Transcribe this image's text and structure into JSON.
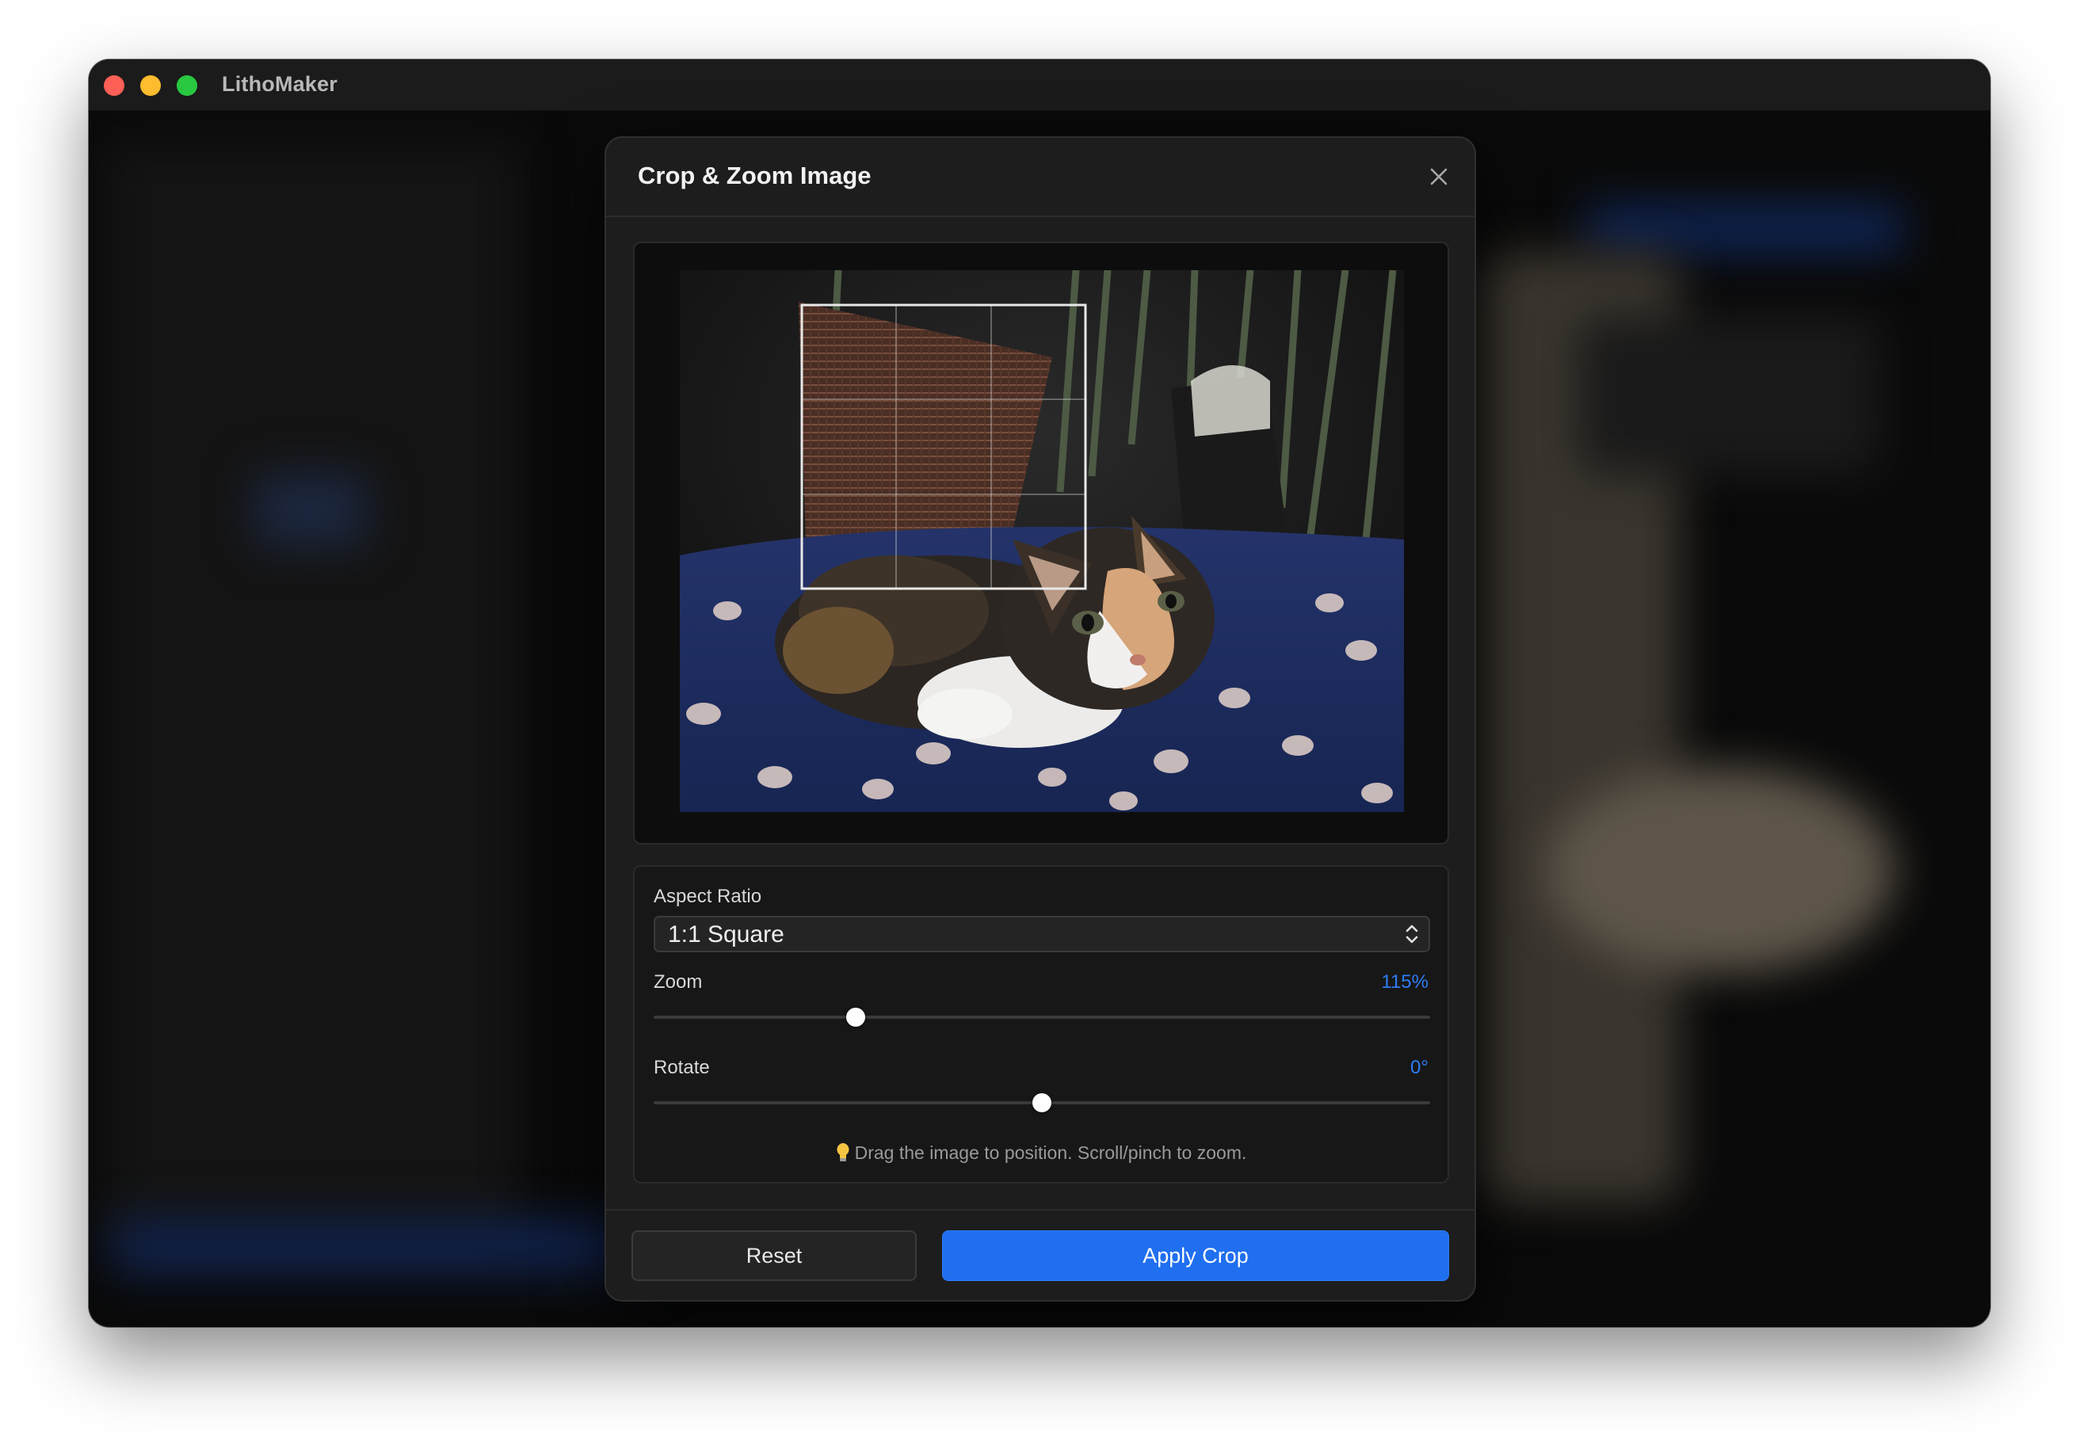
{
  "window": {
    "title": "LithoMaker"
  },
  "dialog": {
    "title": "Crop & Zoom Image",
    "close_icon": "close-icon"
  },
  "preview": {
    "image": "kitten-photo",
    "crop_grid": "rule-of-thirds"
  },
  "controls": {
    "aspect_ratio": {
      "label": "Aspect Ratio",
      "selected": "1:1 Square"
    },
    "zoom": {
      "label": "Zoom",
      "value_text": "115%",
      "slider_fraction": 0.26
    },
    "rotate": {
      "label": "Rotate",
      "value_text": "0°",
      "slider_fraction": 0.5
    },
    "hint": {
      "icon": "lightbulb-icon",
      "text": "Drag the image to position. Scroll/pinch to zoom."
    }
  },
  "footer": {
    "reset_label": "Reset",
    "apply_label": "Apply Crop"
  },
  "colors": {
    "accent": "#1f6ff0",
    "value_text": "#2f7cf6",
    "dialog_bg": "#1d1d1d"
  }
}
